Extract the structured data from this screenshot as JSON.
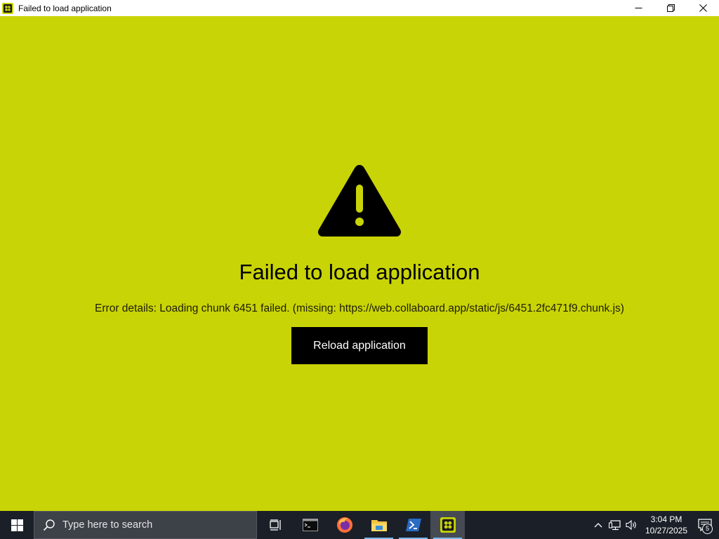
{
  "window": {
    "title": "Failed to load application",
    "icon": "collaboard-app-icon",
    "controls": [
      "minimize-icon",
      "restore-icon",
      "close-icon"
    ]
  },
  "main": {
    "icon": "warning-icon",
    "heading": "Failed to load application",
    "details": "Error details: Loading chunk 6451 failed. (missing: https://web.collaboard.app/static/js/6451.2fc471f9.chunk.js)",
    "reload_label": "Reload application",
    "background_color": "#c9d406"
  },
  "taskbar": {
    "search_placeholder": "Type here to search",
    "apps": [
      {
        "name": "task-view-icon",
        "running": false
      },
      {
        "name": "terminal-icon",
        "running": false
      },
      {
        "name": "firefox-icon",
        "running": false
      },
      {
        "name": "file-explorer-icon",
        "running": true
      },
      {
        "name": "powershell-icon",
        "running": true
      },
      {
        "name": "collaboard-app-icon",
        "running": true,
        "active": true
      }
    ],
    "tray": {
      "time": "3:04 PM",
      "date": "10/27/2025",
      "notification_count": "5"
    }
  }
}
